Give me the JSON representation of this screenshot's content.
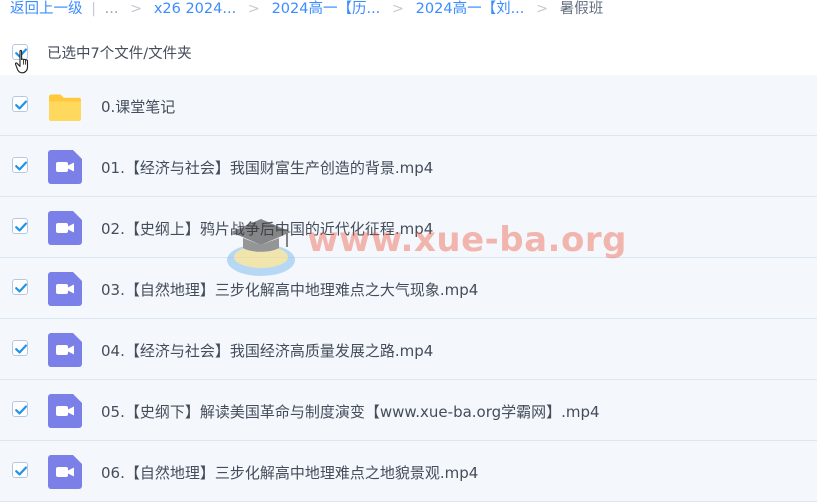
{
  "breadcrumb": {
    "back_label": "返回上一级",
    "divider": "|",
    "ellipsis": "...",
    "separator": ">",
    "items": [
      "x26 2024...",
      "2024高一【历...",
      "2024高一【刘..."
    ],
    "current": "暑假班"
  },
  "selection": {
    "label": "已选中7个文件/文件夹",
    "all_checked": true
  },
  "files": [
    {
      "name": "0.课堂笔记",
      "type": "folder",
      "checked": true
    },
    {
      "name": "01.【经济与社会】我国财富生产创造的背景.mp4",
      "type": "video",
      "checked": true
    },
    {
      "name": "02.【史纲上】鸦片战争后中国的近代化征程.mp4",
      "type": "video",
      "checked": true
    },
    {
      "name": "03.【自然地理】三步化解高中地理难点之大气现象.mp4",
      "type": "video",
      "checked": true
    },
    {
      "name": "04.【经济与社会】我国经济高质量发展之路.mp4",
      "type": "video",
      "checked": true
    },
    {
      "name": "05.【史纲下】解读美国革命与制度演变【www.xue-ba.org学霸网】.mp4",
      "type": "video",
      "checked": true
    },
    {
      "name": "06.【自然地理】三步化解高中地理难点之地貌景观.mp4",
      "type": "video",
      "checked": true
    }
  ],
  "watermark": {
    "text": "www.xue-ba.org"
  },
  "icons": {
    "folder": "folder-icon",
    "video": "video-file-icon",
    "check": "checkmark-icon",
    "cursor": "hand-pointer-icon"
  },
  "colors": {
    "accent": "#3b8cff",
    "checkbox": "#1f94e8",
    "folder": "#ffd55a",
    "video": "#7b7fe8",
    "row_bg": "#f4f8fd"
  }
}
